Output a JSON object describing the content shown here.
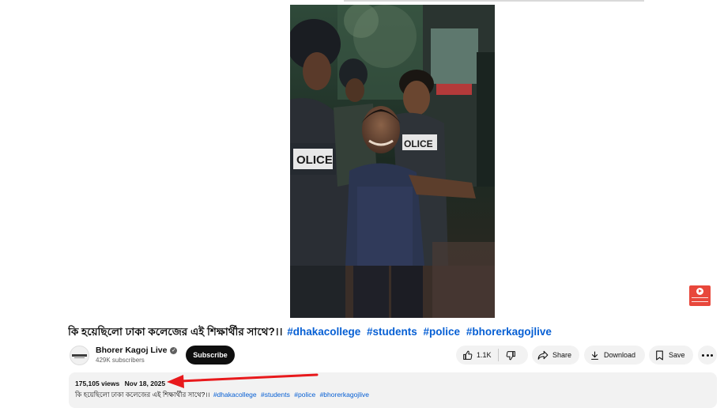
{
  "video": {
    "title": "কি হয়েছিলো ঢাকা কলেজের এই শিক্ষার্থীর সাথে?।।",
    "hashtags": [
      "#dhakacollege",
      "#students",
      "#police",
      "#bhorerkagojlive"
    ],
    "frame_labels": {
      "vest_left": "OLICE",
      "vest_right": "OLICE"
    }
  },
  "channel": {
    "name": "Bhorer Kagoj Live",
    "subscribers": "429K subscribers",
    "verified_icon": "check-icon"
  },
  "actions": {
    "subscribe_label": "Subscribe",
    "like_count": "1.1K",
    "share_label": "Share",
    "download_label": "Download",
    "save_label": "Save"
  },
  "description": {
    "views": "175,105 views",
    "date": "Nov 18, 2025",
    "text": "কি হয়েছিলো ঢাকা কলেজের এই শিক্ষার্থীর সাথে?।।",
    "hashtags": [
      "#dhakacollege",
      "#students",
      "#police",
      "#bhorerkagojlive"
    ]
  },
  "colors": {
    "hashtag": "#065fd4",
    "subscribe_bg": "#0f0f0f",
    "pill_bg": "#f2f2f2",
    "annotation_arrow": "#e8191c",
    "watermark": "#e8473b"
  }
}
